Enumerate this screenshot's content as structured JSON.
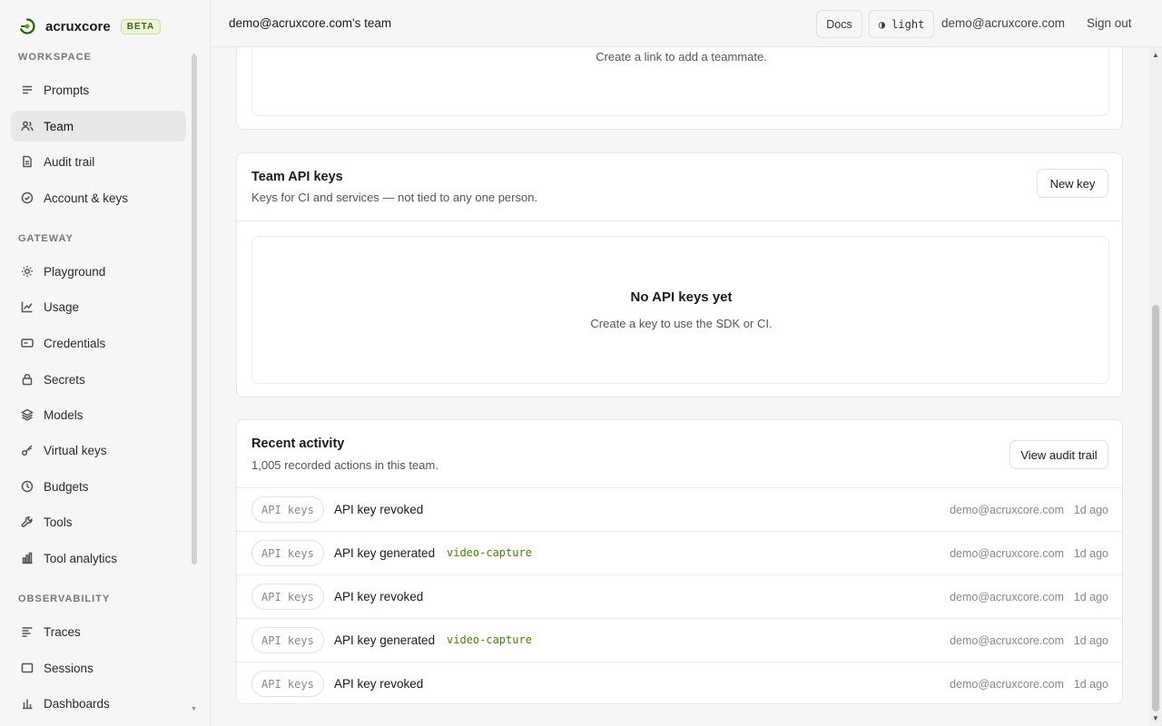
{
  "brand": {
    "name": "acruxcore",
    "badge": "BETA"
  },
  "header": {
    "team_name": "demo@acruxcore.com's team",
    "docs_label": "Docs",
    "theme_label": "◑ light",
    "user_email": "demo@acruxcore.com",
    "signout_label": "Sign out"
  },
  "sidebar": {
    "sections": [
      {
        "label": "WORKSPACE",
        "items": [
          {
            "label": "Prompts",
            "icon": "list-icon"
          },
          {
            "label": "Team",
            "icon": "users-icon",
            "active": true
          },
          {
            "label": "Audit trail",
            "icon": "document-icon"
          },
          {
            "label": "Account & keys",
            "icon": "check-circle-icon"
          }
        ]
      },
      {
        "label": "GATEWAY",
        "items": [
          {
            "label": "Playground",
            "icon": "sun-icon"
          },
          {
            "label": "Usage",
            "icon": "line-chart-icon"
          },
          {
            "label": "Credentials",
            "icon": "card-icon"
          },
          {
            "label": "Secrets",
            "icon": "lock-icon"
          },
          {
            "label": "Models",
            "icon": "layers-icon"
          },
          {
            "label": "Virtual keys",
            "icon": "key-icon"
          },
          {
            "label": "Budgets",
            "icon": "clock-icon"
          },
          {
            "label": "Tools",
            "icon": "wrench-icon"
          },
          {
            "label": "Tool analytics",
            "icon": "bar-chart-icon"
          }
        ]
      },
      {
        "label": "OBSERVABILITY",
        "items": [
          {
            "label": "Traces",
            "icon": "traces-icon"
          },
          {
            "label": "Sessions",
            "icon": "window-icon"
          },
          {
            "label": "Dashboards",
            "icon": "bar-chart-icon"
          }
        ]
      }
    ]
  },
  "invites": {
    "empty_sub": "Create a link to add a teammate."
  },
  "api_keys": {
    "title": "Team API keys",
    "subtitle": "Keys for CI and services — not tied to any one person.",
    "new_key_label": "New key",
    "empty_title": "No API keys yet",
    "empty_sub": "Create a key to use the SDK or CI."
  },
  "activity": {
    "title": "Recent activity",
    "subtitle": "1,005 recorded actions in this team.",
    "view_label": "View audit trail",
    "rows": [
      {
        "category": "API keys",
        "action": "API key revoked",
        "key": "",
        "actor": "demo@acruxcore.com",
        "when": "1d ago"
      },
      {
        "category": "API keys",
        "action": "API key generated",
        "key": "video-capture",
        "actor": "demo@acruxcore.com",
        "when": "1d ago"
      },
      {
        "category": "API keys",
        "action": "API key revoked",
        "key": "",
        "actor": "demo@acruxcore.com",
        "when": "1d ago"
      },
      {
        "category": "API keys",
        "action": "API key generated",
        "key": "video-capture",
        "actor": "demo@acruxcore.com",
        "when": "1d ago"
      },
      {
        "category": "API keys",
        "action": "API key revoked",
        "key": "",
        "actor": "demo@acruxcore.com",
        "when": "1d ago"
      }
    ]
  },
  "colors": {
    "accent": "#4d7c0f",
    "badge_bg": "#ecf5d8"
  }
}
